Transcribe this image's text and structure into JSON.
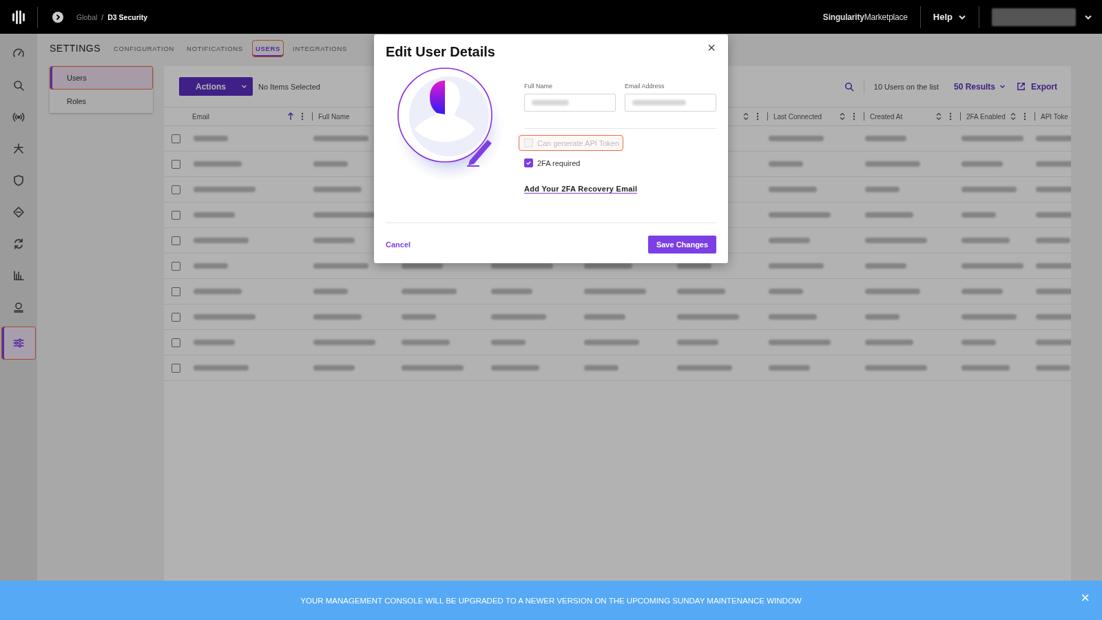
{
  "top_bar": {
    "breadcrumb": [
      "Global",
      "D3 Security"
    ],
    "separator": "/",
    "marketplace": "**Singularity**Marketplace",
    "help": "Help"
  },
  "rail": [
    {
      "selected": false
    },
    {
      "selected": false
    },
    {
      "selected": false
    },
    {
      "selected": false
    },
    {
      "selected": false
    },
    {
      "selected": false
    },
    {
      "selected": false
    },
    {
      "selected": false
    },
    {
      "selected": false
    },
    {
      "selected": true
    }
  ],
  "settings": {
    "title": "SETTINGS",
    "tabs": [
      {
        "label": "CONFIGURATION",
        "selected": false
      },
      {
        "label": "NOTIFICATIONS",
        "selected": false
      },
      {
        "label": "USERS",
        "selected": true
      },
      {
        "label": "INTEGRATIONS",
        "selected": false
      }
    ]
  },
  "subnav": [
    {
      "label": "Users",
      "selected": true
    },
    {
      "label": "Roles",
      "selected": false
    }
  ],
  "toolbar": {
    "actions": "Actions",
    "selection": "No Items Selected",
    "count": "10 Users on the list",
    "results": "50 Results",
    "export": "Export"
  },
  "table": {
    "columns": [
      {
        "kind": "label",
        "label": "Email",
        "sorted": true
      },
      {
        "kind": "label",
        "label": "Full Name"
      },
      {
        "kind": "covered"
      },
      {
        "kind": "covered"
      },
      {
        "kind": "covered"
      },
      {
        "kind": "covered"
      },
      {
        "kind": "label",
        "label": "Last Connected",
        "sorted": false
      },
      {
        "kind": "label",
        "label": "Created At",
        "sorted": false
      },
      {
        "kind": "label",
        "label": "2FA Enabled",
        "sorted": false
      },
      {
        "kind": "label",
        "label": "API Toke"
      }
    ],
    "rows": [
      {
        "checked": false
      },
      {
        "checked": false
      },
      {
        "checked": false
      },
      {
        "checked": false
      },
      {
        "checked": false
      },
      {
        "checked": false
      },
      {
        "checked": false
      },
      {
        "checked": false
      },
      {
        "checked": false
      },
      {
        "checked": false
      }
    ]
  },
  "dialog": {
    "title": "Edit User Details",
    "close": "×",
    "fields": [
      {
        "label": "Full Name"
      },
      {
        "label": "Email Address"
      }
    ],
    "options": [
      {
        "label": "Can generate API Token",
        "checked": false,
        "disabled": true,
        "highlighted": true
      },
      {
        "label": "2FA required",
        "checked": true,
        "disabled": false,
        "highlighted": false
      }
    ],
    "link": "Add Your 2FA Recovery Email",
    "cancel": "Cancel",
    "save": "Save Changes"
  },
  "banner": {
    "text": "YOUR MANAGEMENT CONSOLE WILL BE UPGRADED TO A NEWER VERSION ON THE UPCOMING SUNDAY MAINTENANCE WINDOW",
    "close": "×"
  }
}
